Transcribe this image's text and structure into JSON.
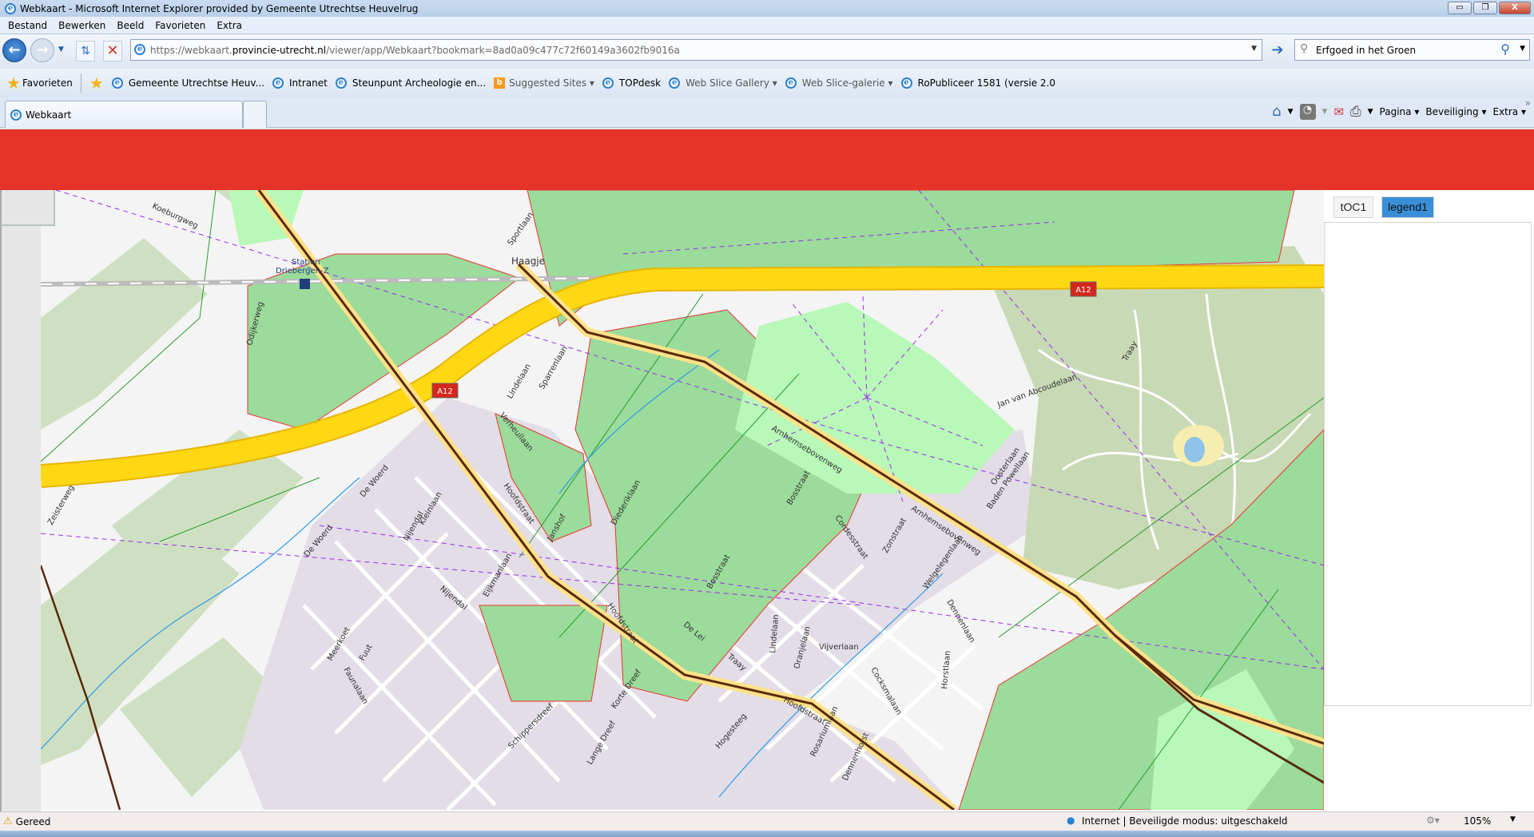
{
  "window": {
    "title": "Webkaart - Microsoft Internet Explorer provided by Gemeente Utrechtse Heuvelrug",
    "minimize": "▭",
    "restore": "❐",
    "close": "X"
  },
  "menu": [
    "Bestand",
    "Bewerken",
    "Beeld",
    "Favorieten",
    "Extra"
  ],
  "address": {
    "prefix": "https://webkaart.",
    "host": "provincie-utrecht.nl",
    "path": "/viewer/app/Webkaart?bookmark=8ad0a09c477c72f60149a3602fb9016a"
  },
  "search": {
    "value": "Erfgoed in het Groen"
  },
  "favorites": {
    "label": "Favorieten",
    "items": [
      "Gemeente Utrechtse Heuv...",
      "Intranet",
      "Steunpunt Archeologie en...",
      "Suggested Sites ▾",
      "TOPdesk",
      "Web Slice Gallery ▾",
      "Web Slice-galerie ▾",
      "RoPubliceer 1581 (versie 2.0"
    ]
  },
  "tabs": [
    {
      "label": "Webkaart"
    }
  ],
  "commandbar": {
    "pagina": "Pagina ▾",
    "beveiliging": "Beveiliging ▾",
    "extra": "Extra ▾"
  },
  "panel": {
    "tabs": [
      {
        "label": "tOC1",
        "active": false
      },
      {
        "label": "legend1",
        "active": true
      }
    ],
    "active_color": "#3a8fd9"
  },
  "map": {
    "road_shield": "A12",
    "labels": {
      "koeburgweg": "Koeburgweg",
      "station": "Station",
      "station2": "Driebergen-Z",
      "odijkerweg": "Odijkerweg",
      "haagje": "Haagje",
      "sportlaan": "Sportlaan",
      "hoofdstraat": "Hoofdstraat",
      "hoofdstraat2": "Hoofdstraat",
      "hoofdstraat3": "Hoofdstraat",
      "arnhemse": "Arnhemsebovenweg",
      "arnhemse2": "Arnhemsebovenweg",
      "sparrenlaan": "Sparrenlaan",
      "lindelaan": "Lindelaan",
      "verheullaan": "Verheullaan",
      "kleinlaan": "Kleinlaan",
      "dewoerd": "De Woerd",
      "dewoerd2": "De Woerd",
      "zeisterweg": "Zeisterweg",
      "niendal": "Nijendal",
      "nijendal": "Nijendal",
      "eijkmanlaan": "Eijkmanlaan",
      "janshof": "Janshof",
      "diederiklaan": "Diederiklaan",
      "bosstraat": "Bosstraat",
      "bosstraat2": "Bosstraat",
      "cordesstraat": "Cordesstraat",
      "zonstraat": "Zonstraat",
      "welgelegenlaan": "Welgelegenlaan",
      "dennenlaan": "Dennenlaan",
      "horstlaan": "Horstlaan",
      "baden": "Baden Powellaan",
      "oosterlaan": "Oosterlaan",
      "jvabcoude": "Jan van Abcoudelaan",
      "traay": "Traay",
      "traay2": "Traay",
      "vijverlaan": "Vijverlaan",
      "oranjelaan": "Oranjelaan",
      "lindelaan2": "Lindelaan",
      "cocksmalaan": "Cocksmalaan",
      "rosariumlaan": "Rosariumlaan",
      "dennenhorst": "Dennenhorst",
      "hogesteeg": "Hogesteeg",
      "delei": "De Lei",
      "meerkoet": "Meerkoet",
      "fuut": "Fuut",
      "faunalaan": "Faunalaan",
      "langedreef": "Lange Dreef",
      "kortedreef": "Korte Dreef",
      "schippersdreef": "Schippersdreef"
    }
  },
  "status": {
    "text": "Gereed",
    "zone": "Internet | Beveiligde modus: uitgeschakeld",
    "zoom": "105%"
  }
}
